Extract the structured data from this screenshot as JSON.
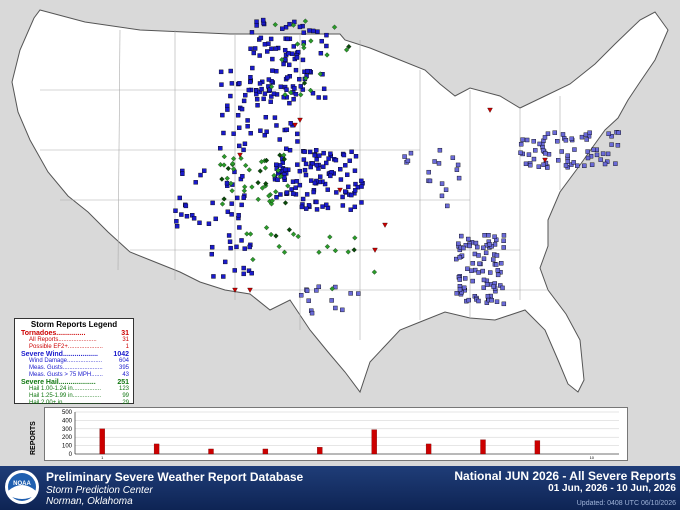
{
  "legend": {
    "title": "Storm Reports Legend",
    "tornadoes": {
      "label": "Tornadoes...............",
      "count": "31",
      "items": [
        {
          "label": "All Reports.......................",
          "count": "31"
        },
        {
          "label": "Possible EF2+.....................",
          "count": "1"
        }
      ]
    },
    "wind": {
      "label": "Severe Wind..................",
      "count": "1042",
      "items": [
        {
          "label": "Wind Damage.....................",
          "count": "604"
        },
        {
          "label": "Meas. Gusts........................",
          "count": "395"
        },
        {
          "label": "Meas. Gusts > 75 MPH.......",
          "count": "43"
        }
      ]
    },
    "hail": {
      "label": "Severe Hail...................",
      "count": "251",
      "items": [
        {
          "label": "Hail 1.00-1.24 in.................",
          "count": "123"
        },
        {
          "label": "Hail 1.25-1.99 in.................",
          "count": "99"
        },
        {
          "label": "Hail 2.00+ in.......................",
          "count": "29"
        }
      ]
    }
  },
  "chart_data": {
    "type": "bar",
    "ylabel": "REPORTS",
    "y_ticks": [
      "500",
      "400",
      "300",
      "200",
      "100",
      "0"
    ],
    "ylim": [
      0,
      500
    ],
    "x": [
      1,
      2,
      3,
      4,
      5,
      6,
      7,
      8,
      9,
      10
    ],
    "x_tick_labels": [
      "1",
      "10"
    ],
    "values": [
      300,
      120,
      60,
      60,
      80,
      290,
      120,
      170,
      160,
      0
    ],
    "bar_color": "#cc0000"
  },
  "footer": {
    "title": "Preliminary Severe Weather Report Database",
    "sub1": "Storm Prediction Center",
    "sub2": "Norman, Oklahoma",
    "right1": "National JUN 2026 - All Severe Reports",
    "right2": "01 Jun, 2026 - 10 Jun, 2026",
    "updated": "Updated: 0408 UTC 06/10/2026",
    "logo_text": "NOAA"
  },
  "colors": {
    "tornado": "#cc0000",
    "wind": "#1a1acc",
    "wind_light": "#6a6ad8",
    "hail": "#2a9a2a",
    "hail_dark": "#0a4a0a",
    "background": "#d9d9d9"
  }
}
